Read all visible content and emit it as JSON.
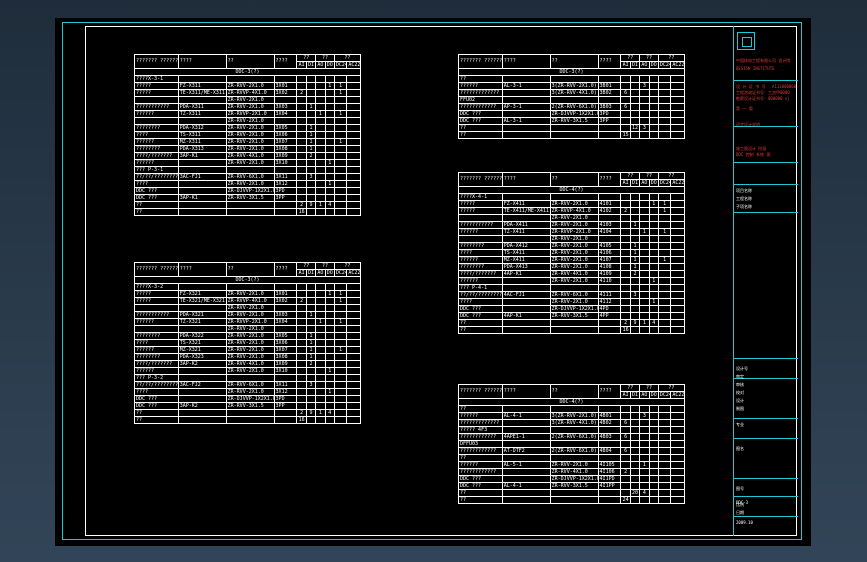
{
  "title_block": {
    "company": "中国核电工程有限公司 设计院",
    "company_en": "DESIGN INSTITUTE",
    "red_notes": [
      "设 计 证 书 号 ：A111000000",
      "工程咨询证书号：工咨甲0000",
      "勘察设计证书号：000000-sj",
      "第 一 版",
      "初步设计说明",
      "施工图设计 阶段",
      "DDC 控制 系统 图"
    ],
    "labels": [
      "项目名称",
      "工程名称",
      "子项名称",
      "设计号",
      "审定",
      "审核",
      "校对",
      "设计",
      "制图",
      "专业",
      "图名",
      "图号",
      "比例",
      "日期"
    ],
    "sheet_code": "DDC-3",
    "date": "2009.10"
  },
  "tables": [
    {
      "header": [
        "??????? ?????????",
        "????",
        "??",
        "????",
        "??",
        "??",
        "??"
      ],
      "subheader": [
        "AI",
        "DI",
        "AO",
        "DO",
        "DC24V",
        "AC220V"
      ],
      "section_title": "DDC-3(?)",
      "rows": [
        [
          "????X-3-1",
          "",
          "",
          "",
          "",
          "",
          "",
          "",
          "",
          ""
        ],
        [
          "?????",
          "FZ-X311",
          "ZR-RVV-2X1.0",
          "3X01",
          "",
          "",
          "",
          "1",
          "1",
          ""
        ],
        [
          "?????",
          "TE-X311/ME-X311",
          "ZR-RVVP-4X1.0",
          "3X02",
          "2",
          "",
          "",
          "",
          "1",
          ""
        ],
        [
          "",
          "",
          "ZR-RVV-2X1.0",
          "",
          "",
          "",
          "",
          "",
          "",
          ""
        ],
        [
          "???????????",
          "PDA-X311",
          "ZR-RVV-2X1.0",
          "3X03",
          "",
          "1",
          "",
          "",
          "",
          ""
        ],
        [
          "??????",
          "TZ-X311",
          "ZR-RVVP-2X1.0",
          "3X04",
          "",
          "",
          "1",
          "",
          "1",
          ""
        ],
        [
          "",
          "",
          "ZR-RVV-2X1.0",
          "",
          "",
          "",
          "",
          "",
          "",
          ""
        ],
        [
          "????????",
          "PDA-X312",
          "ZR-RVV-2X1.0",
          "3X05",
          "",
          "1",
          "",
          "",
          "",
          ""
        ],
        [
          "????",
          "TS-X311",
          "ZR-RVV-2X1.0",
          "3X06",
          "",
          "1",
          "",
          "",
          "",
          ""
        ],
        [
          "??????",
          "MZ-X311",
          "ZR-RVV-2X1.0",
          "3X07",
          "",
          "1",
          "",
          "",
          "1",
          ""
        ],
        [
          "????????",
          "PDA-X313",
          "ZR-RVV-2X1.0",
          "3X08",
          "",
          "1",
          "",
          "",
          "",
          ""
        ],
        [
          "????/???????",
          "3AP-K1",
          "ZR-RVV-4X1.0",
          "3X09",
          "",
          "2",
          "",
          "",
          "",
          ""
        ],
        [
          "??????",
          "",
          "ZR-RVV-2X1.0",
          "3X10",
          "",
          "",
          "",
          "1",
          "",
          ""
        ],
        [
          "??? P-3-1",
          "",
          "",
          "",
          "",
          "",
          "",
          "",
          "",
          ""
        ],
        [
          "??/??/????????",
          "3AC-FJ1",
          "ZR-RVV-6X1.0",
          "3X11",
          "",
          "3",
          "",
          "",
          "",
          ""
        ],
        [
          "????",
          "",
          "ZR-RVV-2X1.0",
          "3X12",
          "",
          "",
          "",
          "1",
          "",
          ""
        ],
        [
          "DDC ???",
          "",
          "ZR-DJVVP-1X2X1.0",
          "3PD",
          "",
          "",
          "",
          "",
          "",
          ""
        ],
        [
          "DDC ???",
          "3AP-K1",
          "ZR-RVV-3X1.5",
          "3PP",
          "",
          "",
          "",
          "",
          "",
          ""
        ],
        [
          "??",
          "",
          "",
          "",
          "2",
          "9",
          "1",
          "4",
          "",
          ""
        ],
        [
          "??",
          "",
          "",
          "",
          "16",
          "",
          "",
          "",
          "",
          ""
        ]
      ]
    },
    {
      "header": [
        "??????? ?????????",
        "????",
        "??",
        "????",
        "??",
        "??",
        "??"
      ],
      "subheader": [
        "AI",
        "DI",
        "AO",
        "DO",
        "DC24V",
        "AC220V"
      ],
      "section_title": "DDC-3(?)",
      "rows": [
        [
          "????X-3-2",
          "",
          "",
          "",
          "",
          "",
          "",
          "",
          "",
          ""
        ],
        [
          "?????",
          "FZ-X321",
          "ZR-RVV-2X1.0",
          "3X01",
          "",
          "",
          "",
          "1",
          "1",
          ""
        ],
        [
          "?????",
          "TE-X321/ME-X321",
          "ZR-RVVP-4X1.0",
          "3X02",
          "2",
          "",
          "",
          "",
          "1",
          ""
        ],
        [
          "",
          "",
          "ZR-RVV-2X1.0",
          "",
          "",
          "",
          "",
          "",
          "",
          ""
        ],
        [
          "???????????",
          "PDA-X321",
          "ZR-RVV-2X1.0",
          "3X03",
          "",
          "1",
          "",
          "",
          "",
          ""
        ],
        [
          "??????",
          "TZ-X321",
          "ZR-RVVP-2X1.0",
          "3X04",
          "",
          "",
          "1",
          "",
          "1",
          ""
        ],
        [
          "",
          "",
          "ZR-RVV-2X1.0",
          "",
          "",
          "",
          "",
          "",
          "",
          ""
        ],
        [
          "????????",
          "PDA-X322",
          "ZR-RVV-2X1.0",
          "3X05",
          "",
          "1",
          "",
          "",
          "",
          ""
        ],
        [
          "????",
          "TS-X321",
          "ZR-RVV-2X1.0",
          "3X06",
          "",
          "1",
          "",
          "",
          "",
          ""
        ],
        [
          "??????",
          "MZ-X321",
          "ZR-RVV-2X1.0",
          "3X07",
          "",
          "1",
          "",
          "",
          "1",
          ""
        ],
        [
          "????????",
          "PDA-X323",
          "ZR-RVV-2X1.0",
          "3X08",
          "",
          "1",
          "",
          "",
          "",
          ""
        ],
        [
          "????/???????",
          "3AP-K2",
          "ZR-RVV-4X1.0",
          "3X09",
          "",
          "2",
          "",
          "",
          "",
          ""
        ],
        [
          "??????",
          "",
          "ZR-RVV-2X1.0",
          "3X10",
          "",
          "",
          "",
          "1",
          "",
          ""
        ],
        [
          "??? P-3-2",
          "",
          "",
          "",
          "",
          "",
          "",
          "",
          "",
          ""
        ],
        [
          "??/??/????????",
          "3AC-FJ2",
          "ZR-RVV-6X1.0",
          "3X11",
          "",
          "3",
          "",
          "",
          "",
          ""
        ],
        [
          "????",
          "",
          "ZR-RVV-2X1.0",
          "3X12",
          "",
          "",
          "",
          "1",
          "",
          ""
        ],
        [
          "DDC ???",
          "",
          "ZR-DJVVP-1X2X1.0",
          "3PD",
          "",
          "",
          "",
          "",
          "",
          ""
        ],
        [
          "DDC ???",
          "3AP-K2",
          "ZR-RVV-3X1.5",
          "3PP",
          "",
          "",
          "",
          "",
          "",
          ""
        ],
        [
          "??",
          "",
          "",
          "",
          "2",
          "9",
          "1",
          "4",
          "",
          ""
        ],
        [
          "??",
          "",
          "",
          "",
          "16",
          "",
          "",
          "",
          "",
          ""
        ]
      ]
    },
    {
      "header": [
        "??????? ?????????",
        "????",
        "??",
        "????",
        "??",
        "??",
        "??"
      ],
      "subheader": [
        "AI",
        "DI",
        "AO",
        "DO",
        "DC24V",
        "AC220V"
      ],
      "section_title": "DDC-3(?)",
      "rows": [
        [
          "??",
          "",
          "",
          "",
          "",
          "",
          "",
          "",
          "",
          ""
        ],
        [
          "??????",
          "AL-3-1",
          "3(ZR-RVV-2X1.0)",
          "3B01",
          "",
          "",
          "3",
          "",
          "",
          ""
        ],
        [
          "?????????????",
          "",
          "3(ZR-RVV-4X1.0)",
          "3B02",
          "6",
          "",
          "",
          "",
          "",
          ""
        ],
        [
          "FFU02",
          "",
          "",
          "",
          "",
          "",
          "",
          "",
          "",
          ""
        ],
        [
          "????????????",
          "AP-3-1",
          "2(ZR-RVV-6X1.0)",
          "3B03",
          "6",
          "",
          "",
          "",
          "",
          ""
        ],
        [
          "DDC ???",
          "",
          "ZR-DJVVP-1X2X1.0",
          "3PD",
          "",
          "",
          "",
          "",
          "",
          ""
        ],
        [
          "DDC ???",
          "AL-3-1",
          "ZR-RVV-3X1.5",
          "3PP",
          "",
          "",
          "",
          "",
          "",
          ""
        ],
        [
          "??",
          "",
          "",
          "",
          "",
          "12",
          "3",
          "",
          "",
          ""
        ],
        [
          "??",
          "",
          "",
          "",
          "15",
          "",
          "",
          "",
          "",
          ""
        ]
      ]
    },
    {
      "header": [
        "??????? ?????????",
        "????",
        "??",
        "????",
        "??",
        "??",
        "??"
      ],
      "subheader": [
        "AI",
        "DI",
        "AO",
        "DO",
        "DC24V",
        "AC220V"
      ],
      "section_title": "DDC-4(?)",
      "rows": [
        [
          "????X-4-1",
          "",
          "",
          "",
          "",
          "",
          "",
          "",
          "",
          ""
        ],
        [
          "?????",
          "FZ-X411",
          "ZR-RVV-2X1.0",
          "4101",
          "",
          "",
          "",
          "1",
          "1",
          ""
        ],
        [
          "?????",
          "TE-X411/ME-X411",
          "ZR-RVVP-4X1.0",
          "4102",
          "2",
          "",
          "",
          "",
          "1",
          ""
        ],
        [
          "",
          "",
          "ZR-RVV-2X1.0",
          "",
          "",
          "",
          "",
          "",
          "",
          ""
        ],
        [
          "???????????",
          "PDA-X411",
          "ZR-RVV-2X1.0",
          "4103",
          "",
          "1",
          "",
          "",
          "",
          ""
        ],
        [
          "??????",
          "TZ-X411",
          "ZR-RVVP-2X1.0",
          "4104",
          "",
          "",
          "1",
          "",
          "1",
          ""
        ],
        [
          "",
          "",
          "ZR-RVV-2X1.0",
          "",
          "",
          "",
          "",
          "",
          "",
          ""
        ],
        [
          "????????",
          "PDA-X412",
          "ZR-RVV-2X1.0",
          "4105",
          "",
          "1",
          "",
          "",
          "",
          ""
        ],
        [
          "????",
          "TS-X411",
          "ZR-RVV-2X1.0",
          "4106",
          "",
          "1",
          "",
          "",
          "",
          ""
        ],
        [
          "??????",
          "MZ-X411",
          "ZR-RVV-2X1.0",
          "4107",
          "",
          "1",
          "",
          "",
          "1",
          ""
        ],
        [
          "????????",
          "PDA-X413",
          "ZR-RVV-2X1.0",
          "4108",
          "",
          "1",
          "",
          "",
          "",
          ""
        ],
        [
          "????/???????",
          "4AP-K1",
          "ZR-RVV-4X1.0",
          "4109",
          "",
          "2",
          "",
          "",
          "",
          ""
        ],
        [
          "??????",
          "",
          "ZR-RVV-2X1.0",
          "4110",
          "",
          "",
          "",
          "1",
          "",
          ""
        ],
        [
          "??? P-4-1",
          "",
          "",
          "",
          "",
          "",
          "",
          "",
          "",
          ""
        ],
        [
          "??/??/????????",
          "4AC-FJ1",
          "ZR-RVV-6X1.0",
          "4111",
          "",
          "3",
          "",
          "",
          "",
          ""
        ],
        [
          "????",
          "",
          "ZR-RVV-2X1.0",
          "4112",
          "",
          "",
          "",
          "1",
          "",
          ""
        ],
        [
          "DDC ???",
          "",
          "ZR-DJVVP-1X2X1.0",
          "4PD",
          "",
          "",
          "",
          "",
          "",
          ""
        ],
        [
          "DDC ???",
          "4AP-K1",
          "ZR-RVV-3X1.5",
          "4PP",
          "",
          "",
          "",
          "",
          "",
          ""
        ],
        [
          "??",
          "",
          "",
          "",
          "2",
          "9",
          "1",
          "4",
          "",
          ""
        ],
        [
          "??",
          "",
          "",
          "",
          "16",
          "",
          "",
          "",
          "",
          ""
        ]
      ]
    },
    {
      "header": [
        "??????? ?????????",
        "????",
        "??",
        "????",
        "??",
        "??",
        "??"
      ],
      "subheader": [
        "AI",
        "DI",
        "AO",
        "DO",
        "DC24V",
        "AC220V"
      ],
      "section_title": "DDC-4(?)",
      "rows": [
        [
          "??",
          "",
          "",
          "",
          "",
          "",
          "",
          "",
          "",
          ""
        ],
        [
          "??????",
          "AL-4-1",
          "3(ZR-RVV-2X1.0)",
          "4B01",
          "",
          "",
          "3",
          "",
          "",
          ""
        ],
        [
          "?????????????",
          "",
          "3(ZR-RVV-4X1.0)",
          "4B02",
          "6",
          "",
          "",
          "",
          "",
          ""
        ],
        [
          "????? 4F3",
          "",
          "",
          "",
          "",
          "",
          "",
          "",
          "",
          ""
        ],
        [
          "????????????",
          "4APE1-1",
          "2(ZR-RVV-6X1.0)",
          "4B03",
          "6",
          "",
          "",
          "",
          "",
          ""
        ],
        [
          "DFFU03",
          "",
          "",
          "",
          "",
          "",
          "",
          "",
          "",
          ""
        ],
        [
          "????????????",
          "AT-DTF2",
          "2(ZR-RVV-6X1.0)",
          "4B04",
          "6",
          "",
          "",
          "",
          "",
          ""
        ],
        [
          "??",
          "",
          "",
          "",
          "",
          "",
          "",
          "",
          "",
          ""
        ],
        [
          "??????",
          "AL-5-1",
          "ZR-RVV-2X1.0",
          "4I105",
          "",
          "",
          "1",
          "",
          "",
          ""
        ],
        [
          "????????????",
          "",
          "ZR-RVV-4X1.0",
          "4I106",
          "2",
          "",
          "",
          "",
          "",
          ""
        ],
        [
          "DDC ???",
          "",
          "ZR-DJVVP-1X2X1.0",
          "4I1PD",
          "",
          "",
          "",
          "",
          "",
          ""
        ],
        [
          "DDC ???",
          "AL-4-1",
          "ZR-RVV-3X1.5",
          "4I1PP",
          "",
          "",
          "",
          "",
          "",
          ""
        ],
        [
          "??",
          "",
          "",
          "",
          "",
          "20",
          "4",
          "",
          "",
          ""
        ],
        [
          "??",
          "",
          "",
          "",
          "24",
          "",
          "",
          "",
          "",
          ""
        ]
      ]
    }
  ]
}
